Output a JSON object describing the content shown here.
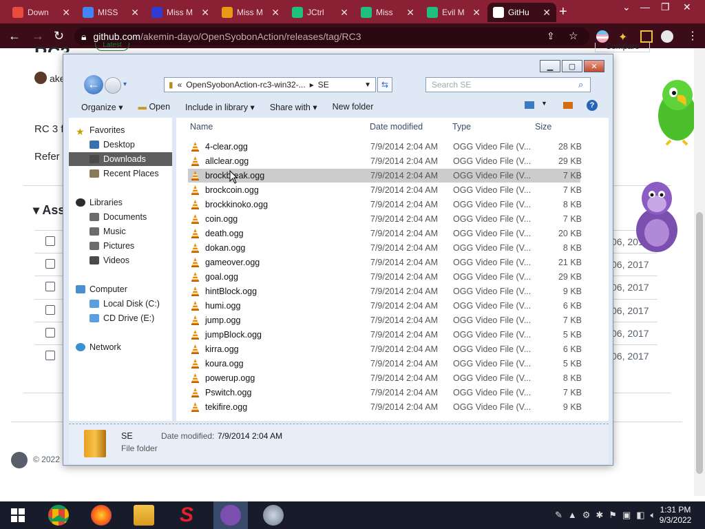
{
  "browser": {
    "tabs": [
      {
        "label": "Down",
        "color": "#e84c3d"
      },
      {
        "label": "MISS",
        "color": "#4285f4"
      },
      {
        "label": "Miss M",
        "color": "#2f3bd1"
      },
      {
        "label": "Miss M",
        "color": "#e89a17"
      },
      {
        "label": "JCtrl",
        "color": "#1fbf80"
      },
      {
        "label": "Miss",
        "color": "#1fbf80"
      },
      {
        "label": "Evil M",
        "color": "#1fbf80"
      },
      {
        "label": "GitHu",
        "color": "#ffffff"
      }
    ],
    "url_domain": "github.com",
    "url_path": "/akemin-dayo/OpenSyobonAction/releases/tag/RC3"
  },
  "github": {
    "title": "RC3",
    "user": "ake",
    "line1": "RC 3 f",
    "line2": "Refer",
    "assets_heading": "Ass",
    "compare_label": "Compare",
    "latest_label": "Latest",
    "asset_dates": [
      "06, 2017",
      "06, 2017",
      "06, 2017",
      "06, 2017",
      "06, 2017",
      "06, 2017"
    ],
    "footer": "© 2022"
  },
  "explorer": {
    "breadcrumb": [
      "«",
      "OpenSyobonAction-rc3-win32-...",
      "▸",
      "SE"
    ],
    "search_placeholder": "Search SE",
    "toolbar": {
      "organize": "Organize ▾",
      "open": "Open",
      "include": "Include in library ▾",
      "share": "Share with ▾",
      "new_folder": "New folder"
    },
    "nav": {
      "favorites": "Favorites",
      "desktop": "Desktop",
      "downloads": "Downloads",
      "recent": "Recent Places",
      "libraries": "Libraries",
      "documents": "Documents",
      "music": "Music",
      "pictures": "Pictures",
      "videos": "Videos",
      "computer": "Computer",
      "local_disk": "Local Disk (C:)",
      "cd_drive": "CD Drive (E:)",
      "network": "Network"
    },
    "columns": {
      "name": "Name",
      "date": "Date modified",
      "type": "Type",
      "size": "Size"
    },
    "files": [
      {
        "name": "4-clear.ogg",
        "date": "7/9/2014 2:04 AM",
        "type": "OGG Video File (V...",
        "size": "28 KB"
      },
      {
        "name": "allclear.ogg",
        "date": "7/9/2014 2:04 AM",
        "type": "OGG Video File (V...",
        "size": "29 KB"
      },
      {
        "name": "brockbreak.ogg",
        "date": "7/9/2014 2:04 AM",
        "type": "OGG Video File (V...",
        "size": "7 KB"
      },
      {
        "name": "brockcoin.ogg",
        "date": "7/9/2014 2:04 AM",
        "type": "OGG Video File (V...",
        "size": "7 KB"
      },
      {
        "name": "brockkinoko.ogg",
        "date": "7/9/2014 2:04 AM",
        "type": "OGG Video File (V...",
        "size": "8 KB"
      },
      {
        "name": "coin.ogg",
        "date": "7/9/2014 2:04 AM",
        "type": "OGG Video File (V...",
        "size": "7 KB"
      },
      {
        "name": "death.ogg",
        "date": "7/9/2014 2:04 AM",
        "type": "OGG Video File (V...",
        "size": "20 KB"
      },
      {
        "name": "dokan.ogg",
        "date": "7/9/2014 2:04 AM",
        "type": "OGG Video File (V...",
        "size": "8 KB"
      },
      {
        "name": "gameover.ogg",
        "date": "7/9/2014 2:04 AM",
        "type": "OGG Video File (V...",
        "size": "21 KB"
      },
      {
        "name": "goal.ogg",
        "date": "7/9/2014 2:04 AM",
        "type": "OGG Video File (V...",
        "size": "29 KB"
      },
      {
        "name": "hintBlock.ogg",
        "date": "7/9/2014 2:04 AM",
        "type": "OGG Video File (V...",
        "size": "9 KB"
      },
      {
        "name": "humi.ogg",
        "date": "7/9/2014 2:04 AM",
        "type": "OGG Video File (V...",
        "size": "6 KB"
      },
      {
        "name": "jump.ogg",
        "date": "7/9/2014 2:04 AM",
        "type": "OGG Video File (V...",
        "size": "7 KB"
      },
      {
        "name": "jumpBlock.ogg",
        "date": "7/9/2014 2:04 AM",
        "type": "OGG Video File (V...",
        "size": "5 KB"
      },
      {
        "name": "kirra.ogg",
        "date": "7/9/2014 2:04 AM",
        "type": "OGG Video File (V...",
        "size": "6 KB"
      },
      {
        "name": "koura.ogg",
        "date": "7/9/2014 2:04 AM",
        "type": "OGG Video File (V...",
        "size": "5 KB"
      },
      {
        "name": "powerup.ogg",
        "date": "7/9/2014 2:04 AM",
        "type": "OGG Video File (V...",
        "size": "8 KB"
      },
      {
        "name": "Pswitch.ogg",
        "date": "7/9/2014 2:04 AM",
        "type": "OGG Video File (V...",
        "size": "7 KB"
      },
      {
        "name": "tekifire.ogg",
        "date": "7/9/2014 2:04 AM",
        "type": "OGG Video File (V...",
        "size": "9 KB"
      }
    ],
    "selected_index": 2,
    "details": {
      "name": "SE",
      "type": "File folder",
      "date_label": "Date modified:",
      "date_value": "7/9/2014 2:04 AM"
    }
  },
  "taskbar": {
    "time": "1:31 PM",
    "date": "9/3/2022"
  }
}
